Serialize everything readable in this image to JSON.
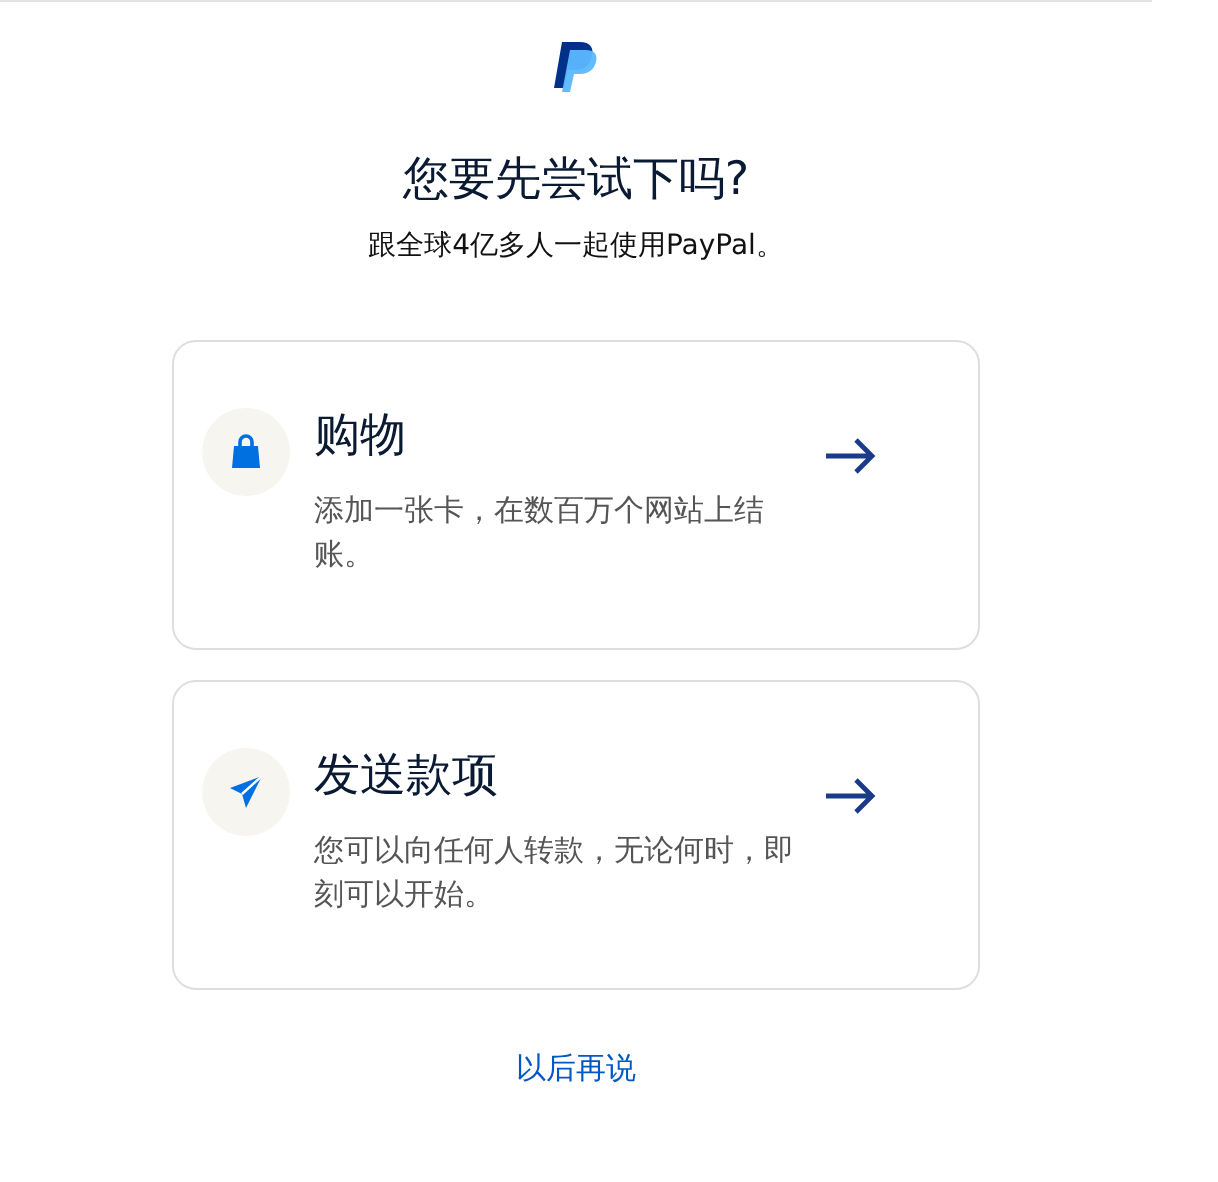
{
  "title": "您要先尝试下吗?",
  "subtitle": "跟全球4亿多人一起使用PayPal。",
  "options": [
    {
      "kind": "shop",
      "title": "购物",
      "description": "添加一张卡，在数百万个网站上结账。"
    },
    {
      "kind": "send",
      "title": "发送款项",
      "description": "您可以向任何人转款，无论何时，即刻可以开始。"
    }
  ],
  "link": "以后再说"
}
